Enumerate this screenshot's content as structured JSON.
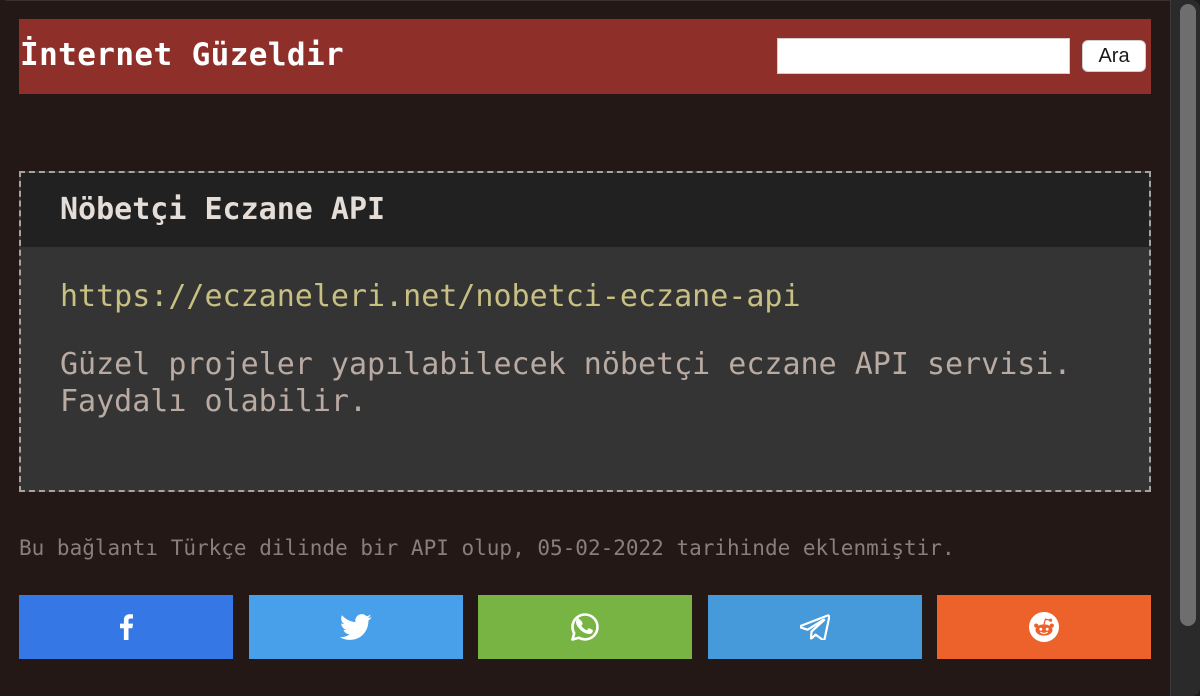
{
  "header": {
    "site_title": "İnternet Güzeldir",
    "search_placeholder": "",
    "search_value": "",
    "search_button_label": "Ara"
  },
  "entry": {
    "title": "Nöbetçi Eczane API",
    "url": "https://eczaneleri.net/nobetci-eczane-api",
    "description": "Güzel projeler yapılabilecek nöbetçi eczane API servisi. Faydalı olabilir."
  },
  "meta_text": "Bu bağlantı Türkçe dilinde bir API olup, 05-02-2022 tarihinde eklenmiştir.",
  "share_buttons": [
    {
      "name": "facebook",
      "icon": "facebook-icon",
      "color": "#3578e5"
    },
    {
      "name": "twitter",
      "icon": "twitter-icon",
      "color": "#48a0eb"
    },
    {
      "name": "whatsapp",
      "icon": "whatsapp-icon",
      "color": "#78b444"
    },
    {
      "name": "telegram",
      "icon": "telegram-icon",
      "color": "#469ad9"
    },
    {
      "name": "reddit",
      "icon": "reddit-icon",
      "color": "#ed622b"
    }
  ],
  "colors": {
    "background": "#231816",
    "header_bg": "#8f2f29",
    "card_bg": "#343434",
    "card_header_bg": "#212121",
    "link": "#c8bf82",
    "description": "#b9aaa2",
    "meta": "#8a7e79"
  }
}
